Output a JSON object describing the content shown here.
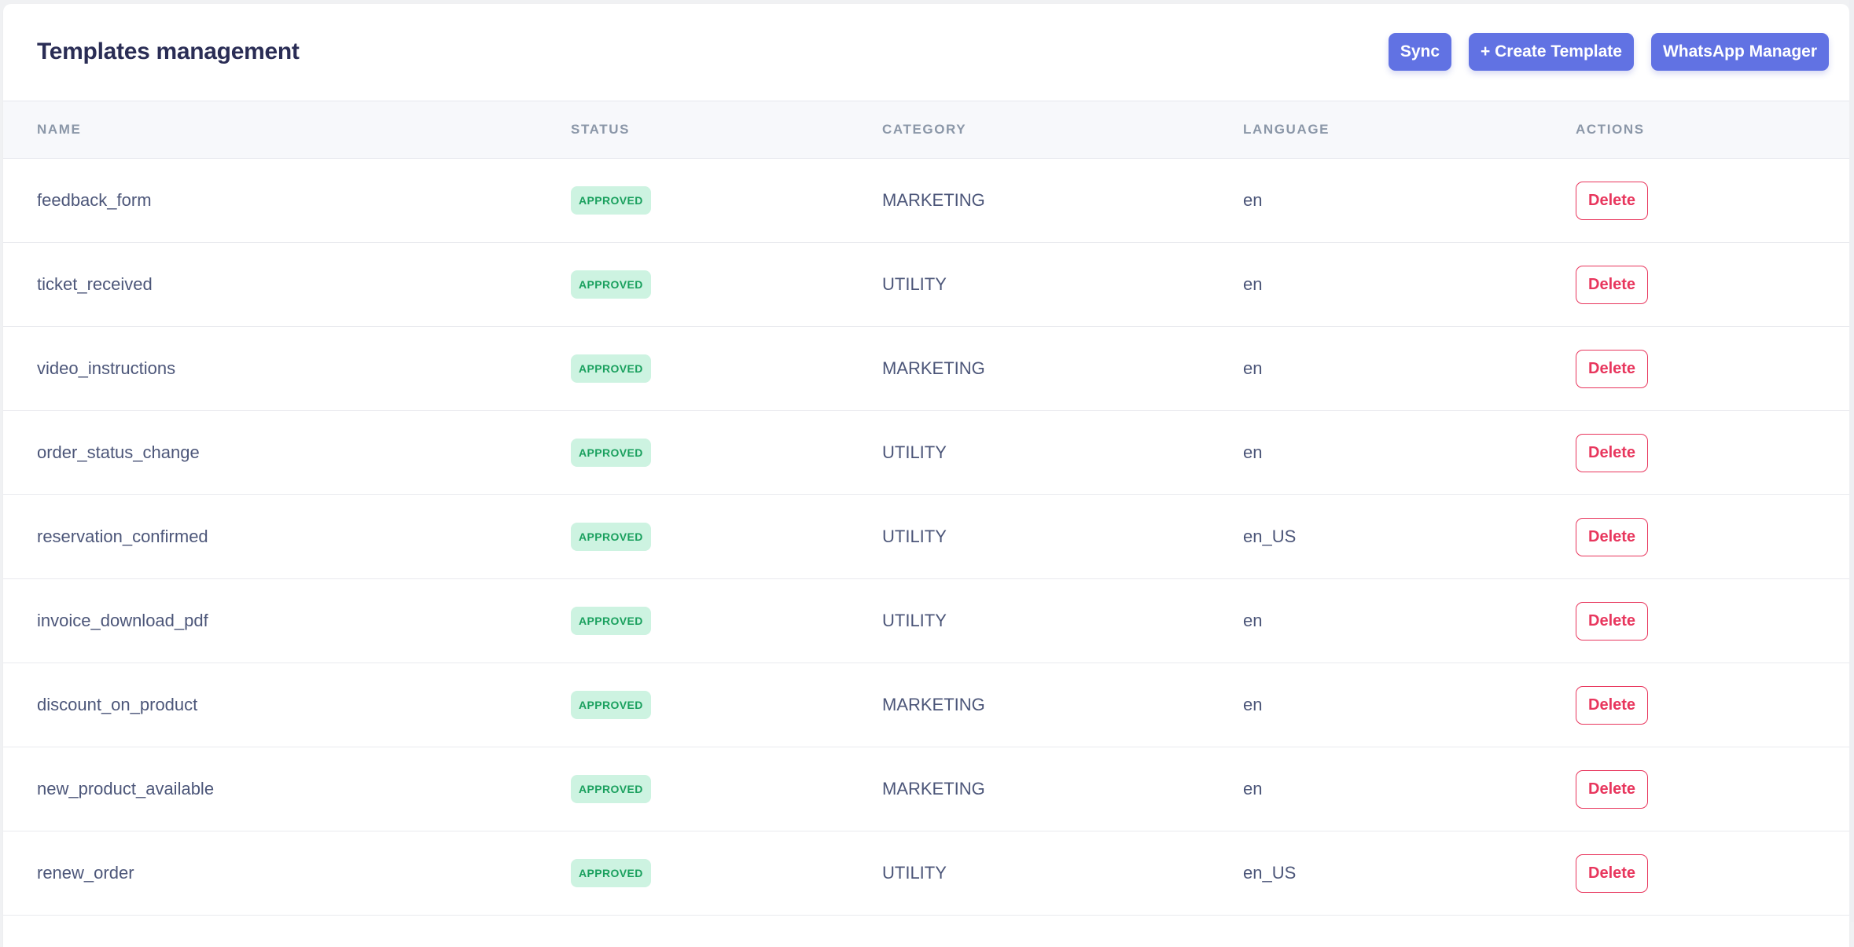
{
  "header": {
    "title": "Templates management",
    "buttons": {
      "sync": "Sync",
      "create": "+ Create Template",
      "whatsapp": "WhatsApp Manager"
    }
  },
  "table": {
    "columns": {
      "name": "NAME",
      "status": "STATUS",
      "category": "CATEGORY",
      "language": "LANGUAGE",
      "actions": "ACTIONS"
    },
    "rows": [
      {
        "name": "feedback_form",
        "status": "APPROVED",
        "category": "MARKETING",
        "language": "en",
        "action": "Delete"
      },
      {
        "name": "ticket_received",
        "status": "APPROVED",
        "category": "UTILITY",
        "language": "en",
        "action": "Delete"
      },
      {
        "name": "video_instructions",
        "status": "APPROVED",
        "category": "MARKETING",
        "language": "en",
        "action": "Delete"
      },
      {
        "name": "order_status_change",
        "status": "APPROVED",
        "category": "UTILITY",
        "language": "en",
        "action": "Delete"
      },
      {
        "name": "reservation_confirmed",
        "status": "APPROVED",
        "category": "UTILITY",
        "language": "en_US",
        "action": "Delete"
      },
      {
        "name": "invoice_download_pdf",
        "status": "APPROVED",
        "category": "UTILITY",
        "language": "en",
        "action": "Delete"
      },
      {
        "name": "discount_on_product",
        "status": "APPROVED",
        "category": "MARKETING",
        "language": "en",
        "action": "Delete"
      },
      {
        "name": "new_product_available",
        "status": "APPROVED",
        "category": "MARKETING",
        "language": "en",
        "action": "Delete"
      },
      {
        "name": "renew_order",
        "status": "APPROVED",
        "category": "UTILITY",
        "language": "en_US",
        "action": "Delete"
      }
    ]
  },
  "colors": {
    "primary": "#6172e3",
    "danger": "#e8365d",
    "approved_bg": "#cdf3e1",
    "approved_text": "#1aa05e",
    "title": "#2a2d55"
  }
}
